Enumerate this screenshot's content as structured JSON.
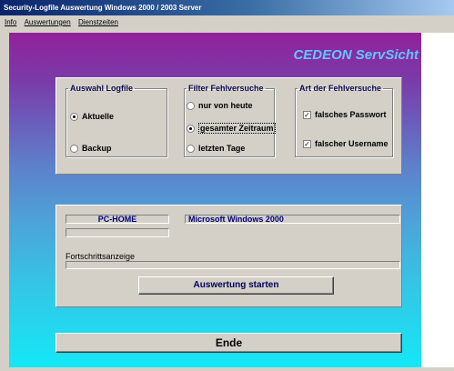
{
  "window": {
    "title": "Security-Logfile Auswertung  Windows 2000 / 2003  Server"
  },
  "menu": [
    "Info",
    "Auswertungen",
    "Dienstzeiten"
  ],
  "brand": "CEDEON ServSicht",
  "logfile": {
    "legend": "Auswahl Logfile",
    "options": [
      {
        "label": "Aktuelle",
        "selected": true
      },
      {
        "label": "Backup",
        "selected": false
      }
    ]
  },
  "filter": {
    "legend": "Filter Fehlversuche",
    "options": [
      {
        "label": "nur von heute",
        "selected": false
      },
      {
        "label": "gesamter Zeitraum",
        "selected": true
      },
      {
        "label": "letzten Tage",
        "selected": false
      }
    ]
  },
  "art": {
    "legend": "Art der Fehlversuche",
    "options": [
      {
        "label": "falsches Passwort",
        "checked": true
      },
      {
        "label": "falscher Username",
        "checked": true
      }
    ]
  },
  "info": {
    "pc_name": "PC-HOME",
    "os_name": "Microsoft Windows 2000",
    "progress_label": "Fortschrittsanzeige",
    "progress": 0
  },
  "buttons": {
    "start": "Auswertung starten",
    "end": "Ende"
  }
}
